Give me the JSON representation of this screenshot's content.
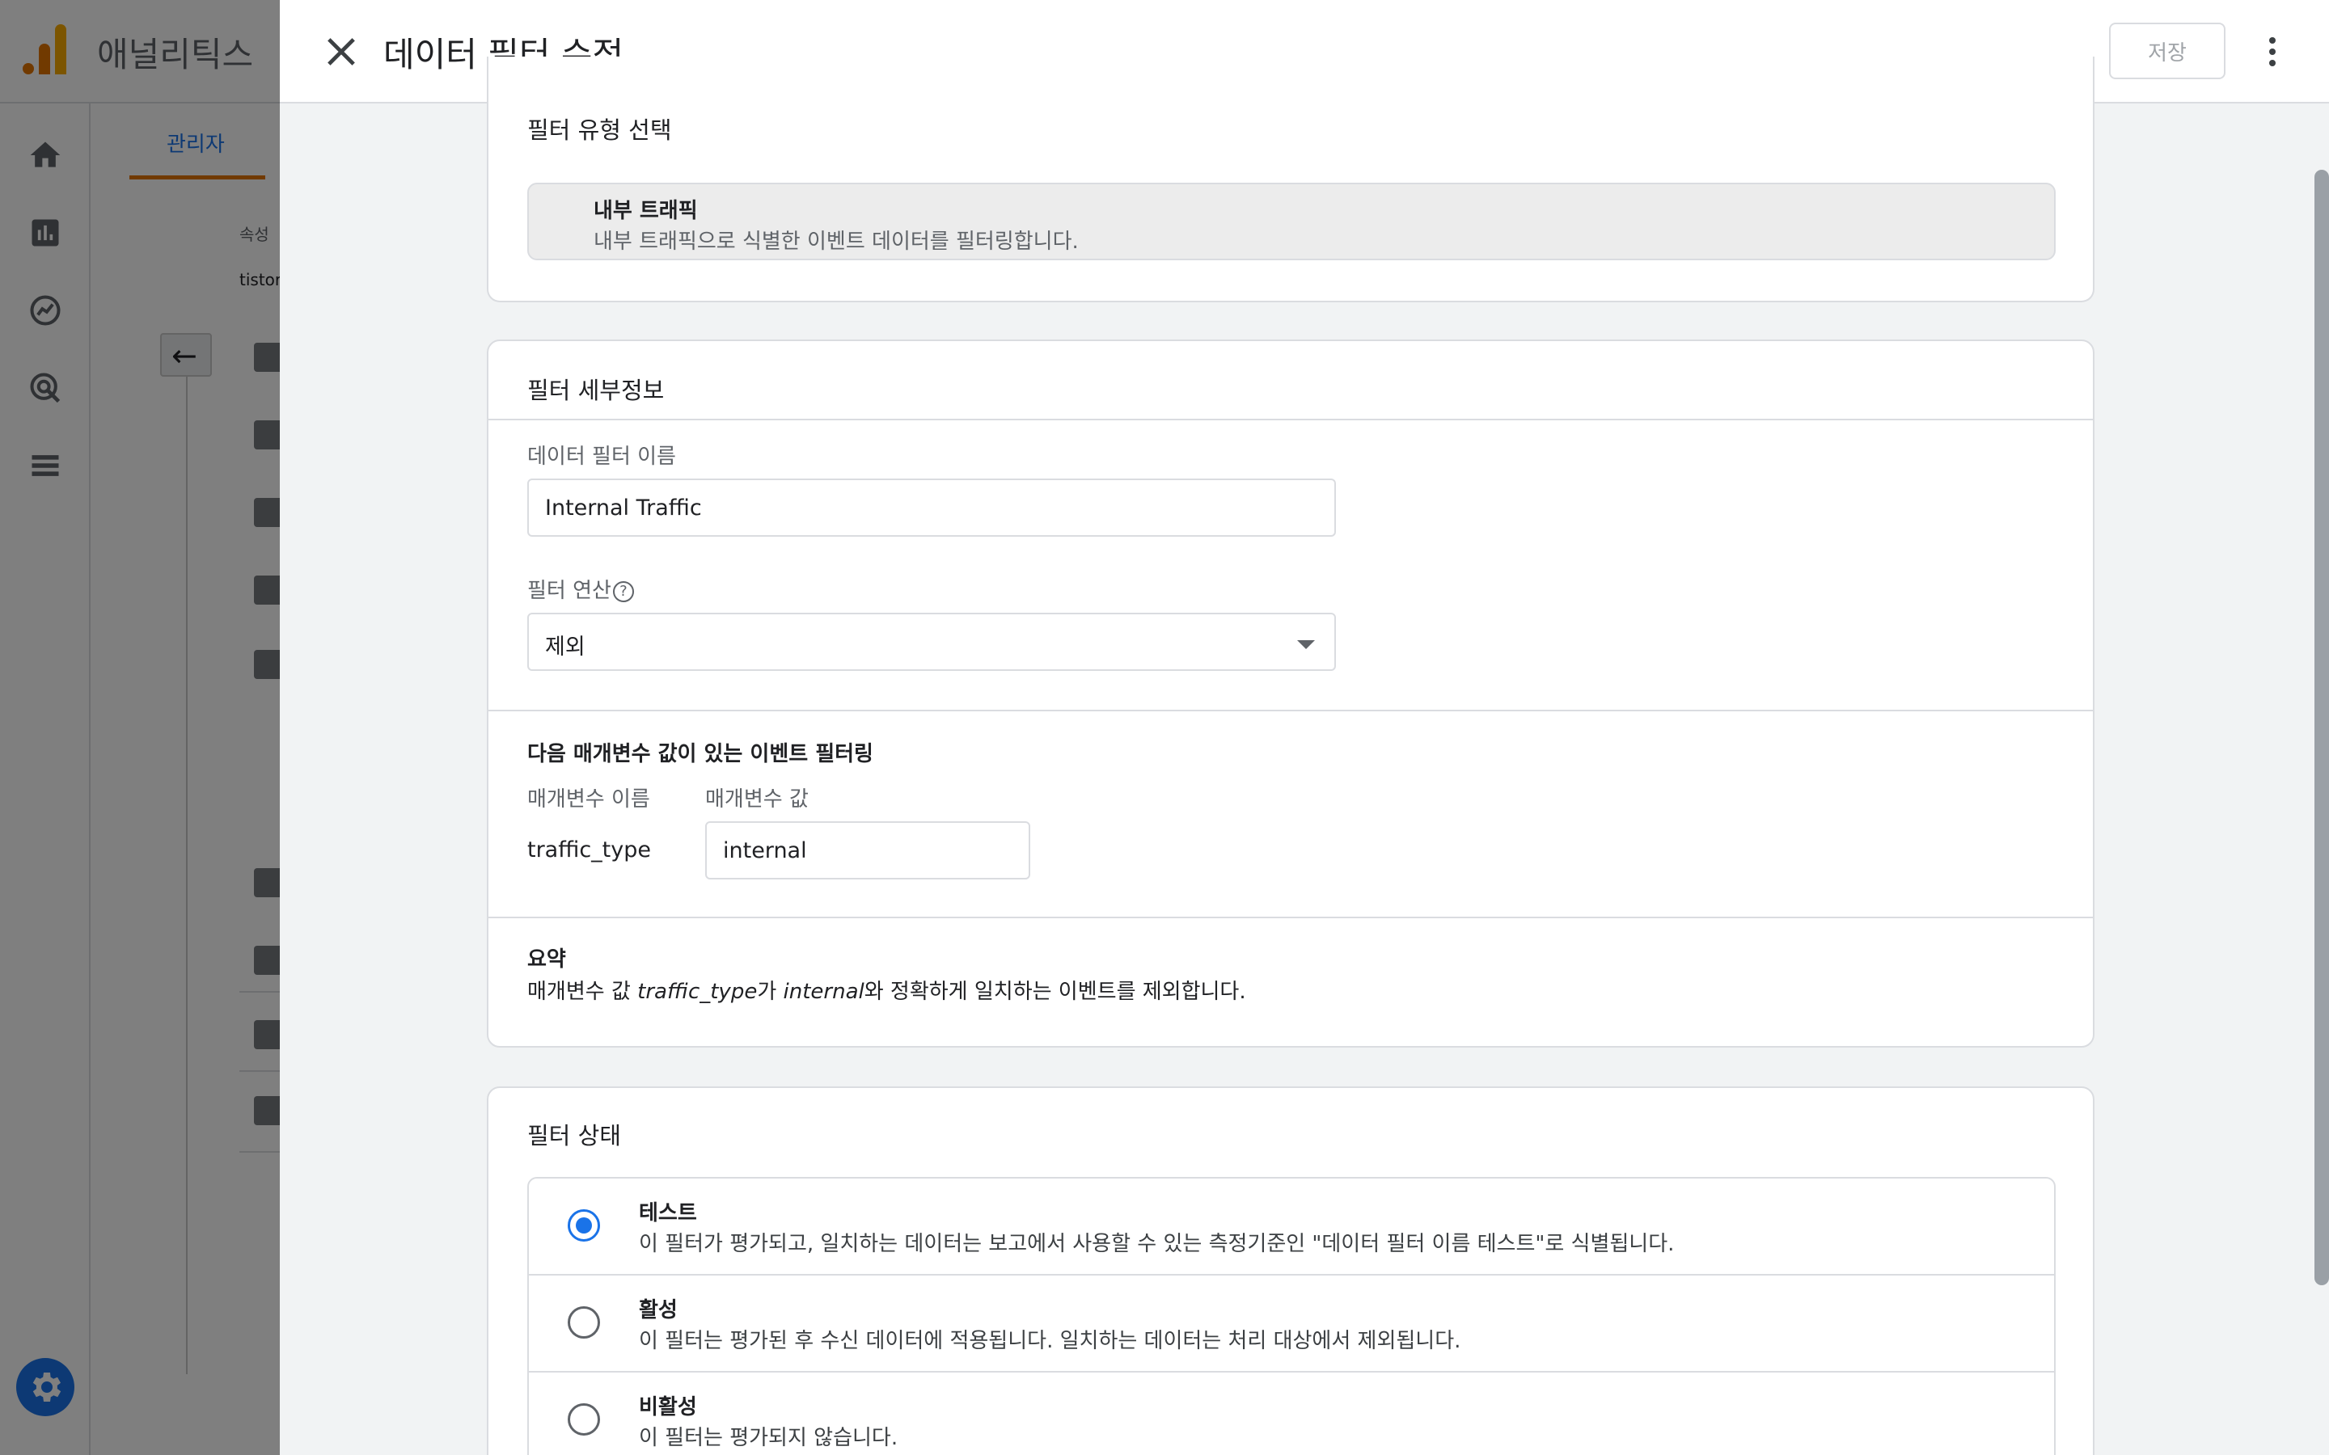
{
  "app": {
    "title": "애널리틱스",
    "admin_tab": "관리자",
    "property_label": "속성",
    "property_value": "tistor"
  },
  "dialog": {
    "title": "데이터 필터 수정",
    "save_label": "저장",
    "filter_type": {
      "heading": "필터 유형 선택",
      "option_title": "내부 트래픽",
      "option_desc": "내부 트래픽으로 식별한 이벤트 데이터를 필터링합니다."
    },
    "details": {
      "heading": "필터 세부정보",
      "name_label": "데이터 필터 이름",
      "name_value": "Internal Traffic",
      "operation_label": "필터 연산",
      "operation_value": "제외",
      "param_heading": "다음 매개변수 값이 있는 이벤트 필터링",
      "param_name_label": "매개변수 이름",
      "param_value_label": "매개변수 값",
      "param_name": "traffic_type",
      "param_value": "internal",
      "summary_title": "요약",
      "summary_prefix": "매개변수 값 ",
      "summary_param": "traffic_type",
      "summary_mid": "가 ",
      "summary_value": "internal",
      "summary_suffix": "와 정확하게 일치하는 이벤트를 제외합니다."
    },
    "state": {
      "heading": "필터 상태",
      "options": [
        {
          "title": "테스트",
          "desc": "이 필터가 평가되고, 일치하는 데이터는 보고에서 사용할 수 있는 측정기준인 \"데이터 필터 이름 테스트\"로 식별됩니다.",
          "selected": true
        },
        {
          "title": "활성",
          "desc": "이 필터는 평가된 후 수신 데이터에 적용됩니다. 일치하는 데이터는 처리 대상에서 제외됩니다.",
          "selected": false
        },
        {
          "title": "비활성",
          "desc": "이 필터는 평가되지 않습니다.",
          "selected": false
        }
      ]
    }
  },
  "colors": {
    "accent": "#1a73e8",
    "brand_orange": "#e37400",
    "brand_yellow": "#f9ab00"
  }
}
